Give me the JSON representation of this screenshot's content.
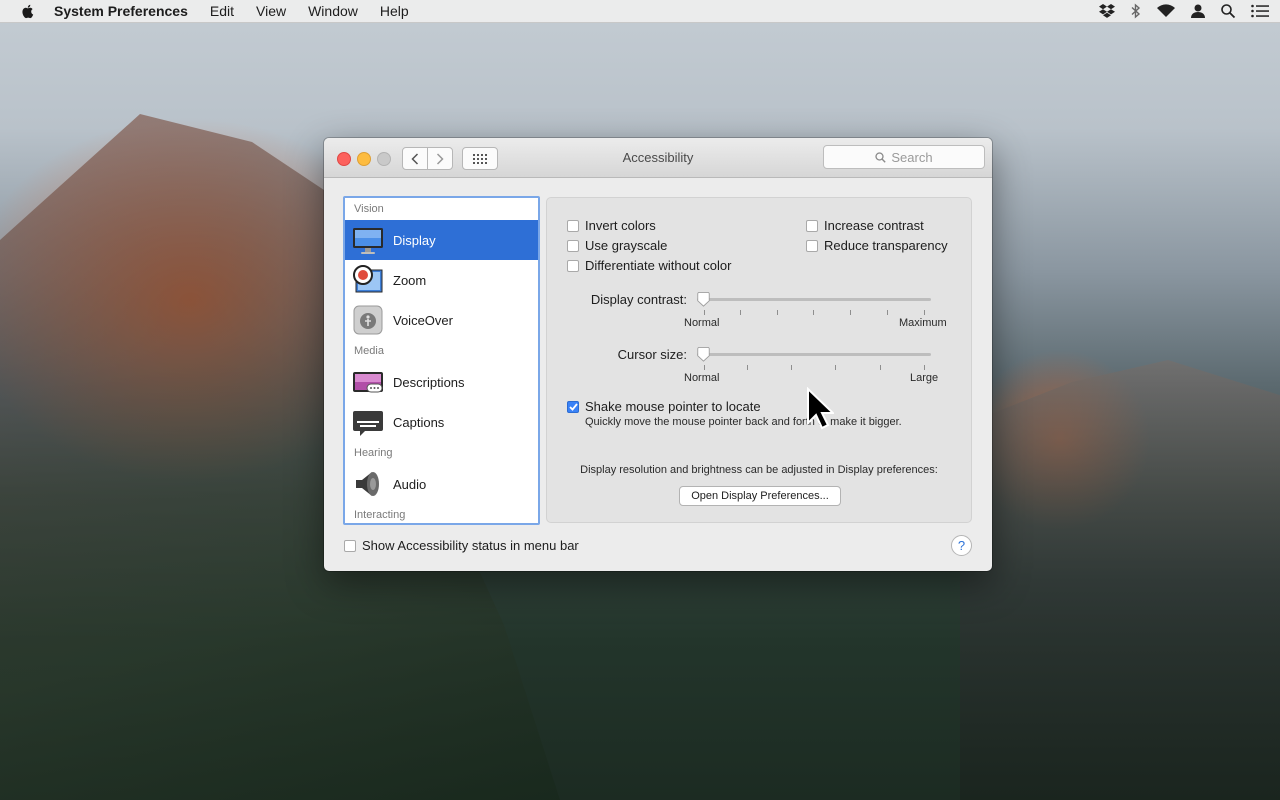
{
  "menubar": {
    "app_name": "System Preferences",
    "items": [
      "Edit",
      "View",
      "Window",
      "Help"
    ],
    "status_icons": [
      "dropbox-icon",
      "bluetooth-icon",
      "wifi-icon",
      "user-icon",
      "spotlight-icon",
      "notification-center-icon"
    ]
  },
  "window": {
    "title": "Accessibility",
    "search_placeholder": "Search"
  },
  "sidebar": {
    "groups": [
      {
        "label": "Vision",
        "items": [
          {
            "label": "Display",
            "icon": "display-icon",
            "selected": true
          },
          {
            "label": "Zoom",
            "icon": "zoom-icon"
          },
          {
            "label": "VoiceOver",
            "icon": "voiceover-icon"
          }
        ]
      },
      {
        "label": "Media",
        "items": [
          {
            "label": "Descriptions",
            "icon": "descriptions-icon"
          },
          {
            "label": "Captions",
            "icon": "captions-icon"
          }
        ]
      },
      {
        "label": "Hearing",
        "items": [
          {
            "label": "Audio",
            "icon": "audio-icon"
          }
        ]
      },
      {
        "label": "Interacting",
        "items": []
      }
    ]
  },
  "display": {
    "invert_colors": "Invert colors",
    "use_grayscale": "Use grayscale",
    "differentiate": "Differentiate without color",
    "increase_contrast": "Increase contrast",
    "reduce_transparency": "Reduce transparency",
    "contrast_label": "Display contrast:",
    "contrast_min": "Normal",
    "contrast_max": "Maximum",
    "contrast_value": 0,
    "cursor_label": "Cursor size:",
    "cursor_min": "Normal",
    "cursor_max": "Large",
    "cursor_value": 0,
    "shake_label": "Shake mouse pointer to locate",
    "shake_checked": true,
    "shake_hint": "Quickly move the mouse pointer back and forth to make it bigger.",
    "resolution_note": "Display resolution and brightness can be adjusted in Display preferences:",
    "open_button": "Open Display Preferences..."
  },
  "footer": {
    "show_status_label": "Show Accessibility status in menu bar",
    "help": "?"
  },
  "colors": {
    "selection": "#2e6fd6",
    "checkbox_checked": "#3a82f7"
  }
}
